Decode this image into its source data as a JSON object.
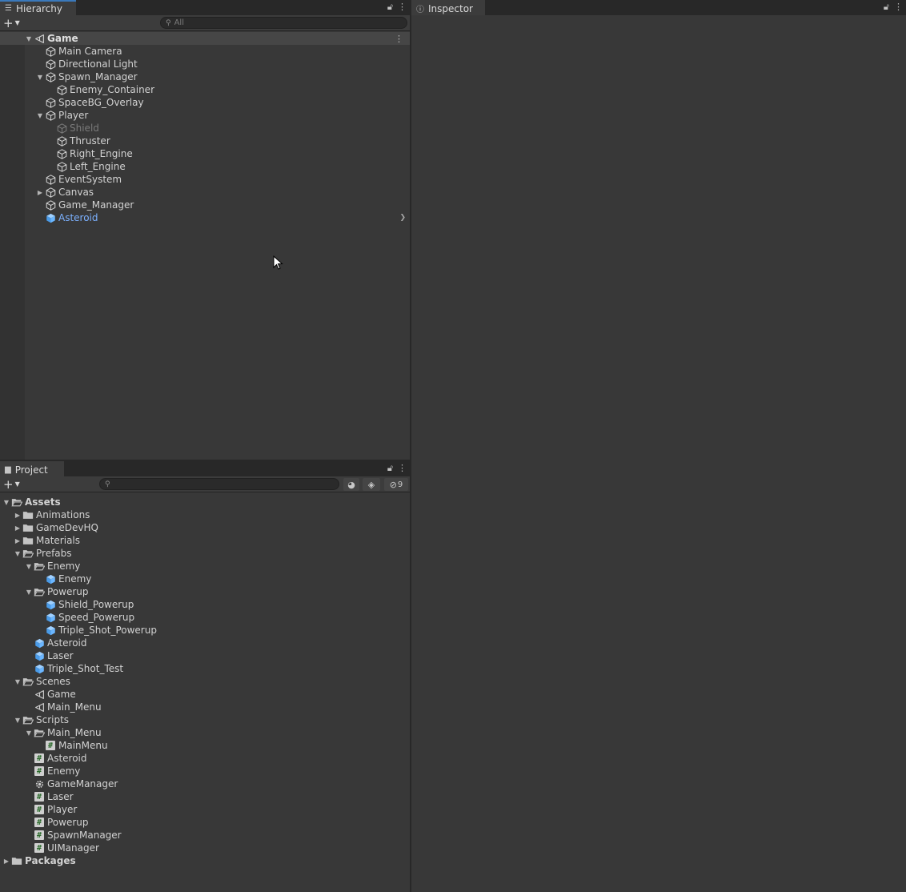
{
  "hierarchy": {
    "tab_label": "Hierarchy",
    "search_placeholder": "All",
    "items": [
      {
        "label": "Game",
        "depth": 0,
        "expanded": true,
        "type": "scene"
      },
      {
        "label": "Main Camera",
        "depth": 1,
        "type": "object"
      },
      {
        "label": "Directional Light",
        "depth": 1,
        "type": "object"
      },
      {
        "label": "Spawn_Manager",
        "depth": 1,
        "expanded": true,
        "type": "object"
      },
      {
        "label": "Enemy_Container",
        "depth": 2,
        "type": "object"
      },
      {
        "label": "SpaceBG_Overlay",
        "depth": 1,
        "type": "object"
      },
      {
        "label": "Player",
        "depth": 1,
        "expanded": true,
        "type": "object"
      },
      {
        "label": "Shield",
        "depth": 2,
        "type": "object",
        "inactive": true
      },
      {
        "label": "Thruster",
        "depth": 2,
        "type": "object"
      },
      {
        "label": "Right_Engine",
        "depth": 2,
        "type": "object"
      },
      {
        "label": "Left_Engine",
        "depth": 2,
        "type": "object"
      },
      {
        "label": "EventSystem",
        "depth": 1,
        "type": "object"
      },
      {
        "label": "Canvas",
        "depth": 1,
        "expanded": false,
        "type": "object"
      },
      {
        "label": "Game_Manager",
        "depth": 1,
        "type": "object"
      },
      {
        "label": "Asteroid",
        "depth": 1,
        "type": "prefab"
      }
    ]
  },
  "project": {
    "tab_label": "Project",
    "search_placeholder": "",
    "hidden_count": "9",
    "items": [
      {
        "label": "Assets",
        "depth": 0,
        "expanded": true,
        "type": "folder-open",
        "bold": true
      },
      {
        "label": "Animations",
        "depth": 1,
        "expanded": false,
        "type": "folder"
      },
      {
        "label": "GameDevHQ",
        "depth": 1,
        "expanded": false,
        "type": "folder"
      },
      {
        "label": "Materials",
        "depth": 1,
        "expanded": false,
        "type": "folder"
      },
      {
        "label": "Prefabs",
        "depth": 1,
        "expanded": true,
        "type": "folder-open"
      },
      {
        "label": "Enemy",
        "depth": 2,
        "expanded": true,
        "type": "folder-open"
      },
      {
        "label": "Enemy",
        "depth": 3,
        "type": "prefab"
      },
      {
        "label": "Powerup",
        "depth": 2,
        "expanded": true,
        "type": "folder-open"
      },
      {
        "label": "Shield_Powerup",
        "depth": 3,
        "type": "prefab"
      },
      {
        "label": "Speed_Powerup",
        "depth": 3,
        "type": "prefab"
      },
      {
        "label": "Triple_Shot_Powerup",
        "depth": 3,
        "type": "prefab"
      },
      {
        "label": "Asteroid",
        "depth": 2,
        "type": "prefab"
      },
      {
        "label": "Laser",
        "depth": 2,
        "type": "prefab"
      },
      {
        "label": "Triple_Shot_Test",
        "depth": 2,
        "type": "prefab"
      },
      {
        "label": "Scenes",
        "depth": 1,
        "expanded": true,
        "type": "folder-open"
      },
      {
        "label": "Game",
        "depth": 2,
        "type": "scene"
      },
      {
        "label": "Main_Menu",
        "depth": 2,
        "type": "scene"
      },
      {
        "label": "Scripts",
        "depth": 1,
        "expanded": true,
        "type": "folder-open"
      },
      {
        "label": "Main_Menu",
        "depth": 2,
        "expanded": true,
        "type": "folder-open"
      },
      {
        "label": "MainMenu",
        "depth": 3,
        "type": "script"
      },
      {
        "label": "Asteroid",
        "depth": 2,
        "type": "script"
      },
      {
        "label": "Enemy",
        "depth": 2,
        "type": "script"
      },
      {
        "label": "GameManager",
        "depth": 2,
        "type": "gear"
      },
      {
        "label": "Laser",
        "depth": 2,
        "type": "script"
      },
      {
        "label": "Player",
        "depth": 2,
        "type": "script"
      },
      {
        "label": "Powerup",
        "depth": 2,
        "type": "script"
      },
      {
        "label": "SpawnManager",
        "depth": 2,
        "type": "script"
      },
      {
        "label": "UIManager",
        "depth": 2,
        "type": "script"
      },
      {
        "label": "Packages",
        "depth": 0,
        "expanded": false,
        "type": "folder",
        "bold": true
      }
    ]
  },
  "inspector": {
    "tab_label": "Inspector"
  },
  "colors": {
    "accent": "#3a79bb",
    "prefab": "#7cb1ff",
    "panel": "#383838"
  }
}
